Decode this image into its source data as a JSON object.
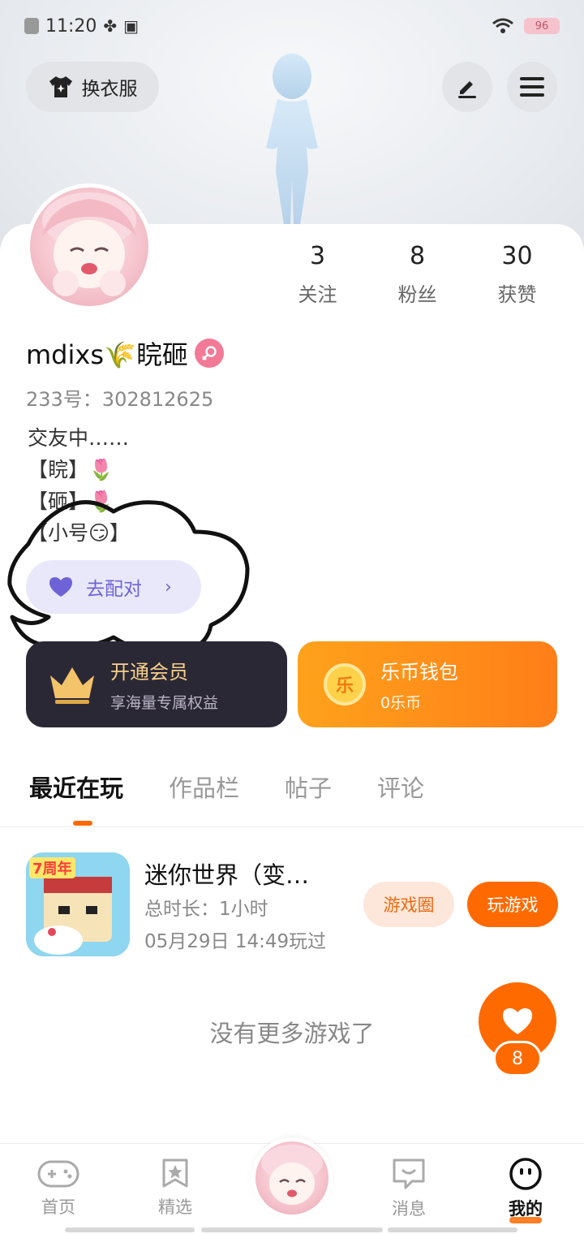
{
  "status_bar": {
    "time": "11:20",
    "battery": "96"
  },
  "header": {
    "outfit_label": "换衣服"
  },
  "profile": {
    "username": "mdixs🌾睆砸",
    "uid": "233号：302812625",
    "bio_lines": [
      "交友中……",
      "【睆】🌷",
      "【砸】🌷",
      "【小号😏】"
    ],
    "stats": [
      {
        "value": "3",
        "label": "关注"
      },
      {
        "value": "8",
        "label": "粉丝"
      },
      {
        "value": "30",
        "label": "获赞"
      }
    ]
  },
  "match_button": {
    "label": "去配对"
  },
  "vip_card": {
    "title": "开通会员",
    "subtitle": "享海量专属权益"
  },
  "wallet_card": {
    "title": "乐币钱包",
    "subtitle": "0乐币",
    "coin_glyph": "乐"
  },
  "tabs": [
    "最近在玩",
    "作品栏",
    "帖子",
    "评论"
  ],
  "recent_game": {
    "title": "迷你世界（变…",
    "duration": "总时长：1小时",
    "last_played": "05月29日 14:49玩过",
    "badge": "7周年",
    "circle_button": "游戏圈",
    "play_button": "玩游戏"
  },
  "no_more_text": "没有更多游戏了",
  "fab": {
    "count": "8"
  },
  "nav": [
    "首页",
    "精选",
    "消息",
    "我的"
  ],
  "colors": {
    "accent": "#ff6a00",
    "vip_bg": "#2b2836",
    "match_text": "#6e63d6"
  }
}
